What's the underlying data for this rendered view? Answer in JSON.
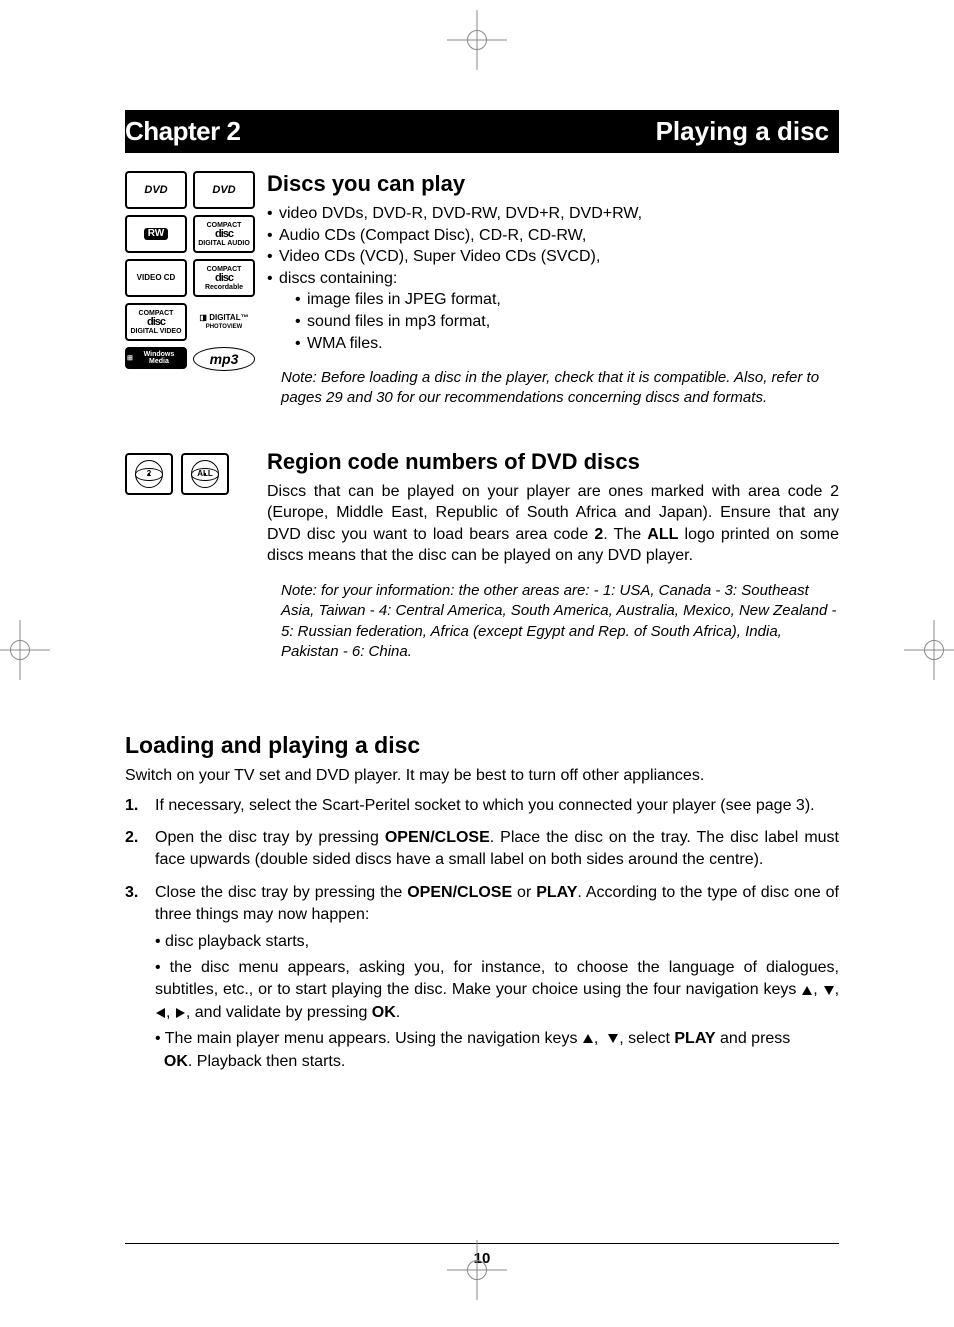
{
  "header": {
    "chapter": "Chapter 2",
    "title": "Playing a disc"
  },
  "icons": {
    "dvd_video": "DVD VIDEO",
    "dvd_r": "DVD R",
    "rw": "RW",
    "cd_da": "COMPACT disc DIGITAL AUDIO",
    "video_cd": "VIDEO CD",
    "cd_r": "COMPACT disc Recordable",
    "cd_dv": "COMPACT disc DIGITAL VIDEO",
    "digital_photoview": "DIGITAL PHOTOVIEW",
    "wma": "Windows Media",
    "mp3": "mp3",
    "region_2": "2",
    "region_all": "ALL"
  },
  "section1": {
    "heading": "Discs you can play",
    "bullets": [
      "video DVDs, DVD-R, DVD-RW, DVD+R, DVD+RW,",
      "Audio CDs (Compact Disc), CD-R, CD-RW,",
      "Video CDs (VCD), Super Video CDs (SVCD),",
      "discs containing:"
    ],
    "sub_bullets": [
      "image files in JPEG format,",
      "sound files in mp3 format,",
      "WMA files."
    ],
    "note": "Note: Before loading a disc in the player, check that it is compatible. Also, refer to pages 29 and 30 for our recommendations concerning discs and formats."
  },
  "section2": {
    "heading": "Region code numbers of DVD discs",
    "para_parts": {
      "p1": "Discs that can be played on your player are ones marked with area code 2 (Europe, Middle East, Republic of South Africa and Japan). Ensure that any DVD disc you want to load bears area code ",
      "bold1": "2",
      "p2": ". The ",
      "bold2": "ALL",
      "p3": " logo printed on some discs means that the disc can be played on any DVD player."
    },
    "note": "Note: for your information: the other areas are: - 1: USA, Canada - 3: Southeast Asia, Taiwan - 4: Central America, South America, Australia, Mexico, New Zealand - 5: Russian federation, Africa (except Egypt and Rep. of South Africa), India, Pakistan - 6: China."
  },
  "section3": {
    "heading": "Loading and playing a disc",
    "intro": "Switch on your TV set and DVD player. It may be best to turn off other appliances.",
    "step1": "If necessary, select the Scart-Peritel socket to which you connected your player (see page 3).",
    "step2": {
      "t1": "Open the disc tray by pressing ",
      "b1": "OPEN/CLOSE",
      "t2": ". Place the disc on the tray. The disc label must face upwards (double sided discs have a small label on both sides around the centre)."
    },
    "step3": {
      "t1": "Close the disc tray by pressing the ",
      "b1": "OPEN/CLOSE",
      "t2": " or ",
      "b2": "PLAY",
      "t3": ". According to the type of disc one of three things may now happen:",
      "sub1": "disc playback starts,",
      "sub2a": "the disc menu appears, asking you, for instance, to choose the language of dialogues, subtitles, etc., or to start playing the disc. Make your choice using the four navigation keys ",
      "sub2b": ", and validate by pressing ",
      "b3": "OK",
      "sub3a": "The main player menu appears. Using the navigation keys ",
      "sub3b": ", select ",
      "b4": "PLAY",
      "sub3c": " and press ",
      "b5": "OK",
      "sub3d": ". Playback then starts."
    }
  },
  "footer": {
    "page_number": "10"
  }
}
